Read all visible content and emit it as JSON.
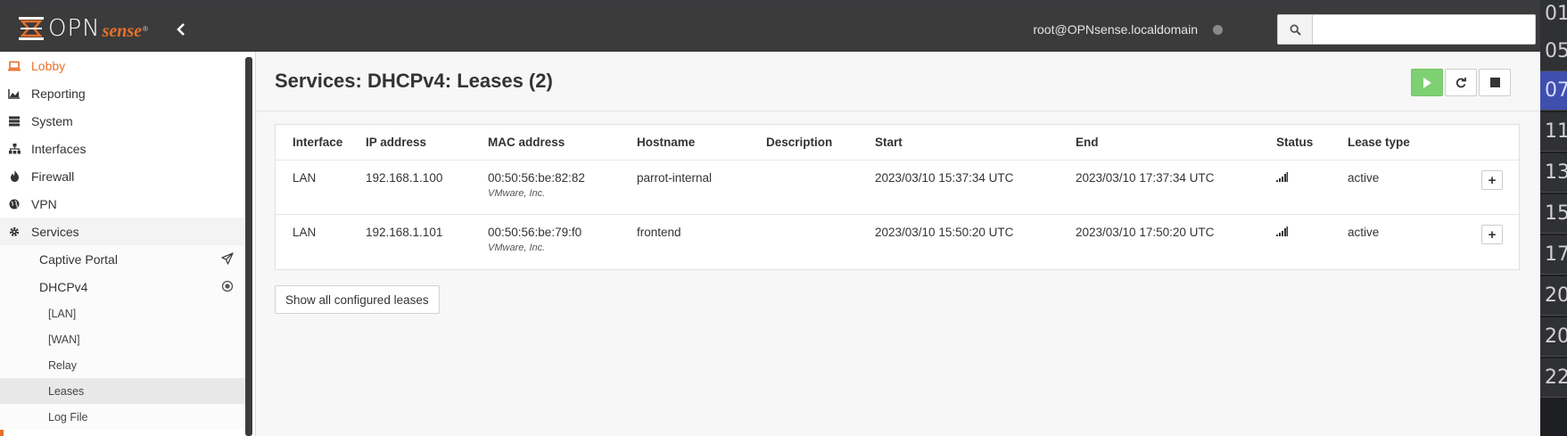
{
  "header": {
    "logo_text": "OPN",
    "logo_sense": "sense",
    "logo_reg": "®",
    "user": "root@OPNsense.localdomain",
    "search_placeholder": ""
  },
  "sidebar": {
    "items": [
      {
        "label": "Lobby",
        "icon": "laptop-icon"
      },
      {
        "label": "Reporting",
        "icon": "area-chart-icon"
      },
      {
        "label": "System",
        "icon": "server-icon"
      },
      {
        "label": "Interfaces",
        "icon": "sitemap-icon"
      },
      {
        "label": "Firewall",
        "icon": "fire-icon"
      },
      {
        "label": "VPN",
        "icon": "globe-icon"
      },
      {
        "label": "Services",
        "icon": "cog-icon"
      }
    ],
    "services_sub": [
      {
        "label": "Captive Portal",
        "icon": "paper-plane-icon"
      },
      {
        "label": "DHCPv4",
        "icon": "bullseye-icon"
      }
    ],
    "dhcp_sub": [
      {
        "label": "[LAN]"
      },
      {
        "label": "[WAN]"
      },
      {
        "label": "Relay"
      },
      {
        "label": "Leases"
      },
      {
        "label": "Log File"
      }
    ]
  },
  "page": {
    "title": "Services: DHCPv4: Leases (2)",
    "show_all_label": "Show all configured leases"
  },
  "table": {
    "columns": [
      "Interface",
      "IP address",
      "MAC address",
      "Hostname",
      "Description",
      "Start",
      "End",
      "Status",
      "Lease type"
    ],
    "rows": [
      {
        "interface": "LAN",
        "ip": "192.168.1.100",
        "mac": "00:50:56:be:82:82",
        "vendor": "VMware, Inc.",
        "hostname": "parrot-internal",
        "description": "",
        "start": "2023/03/10 15:37:34 UTC",
        "end": "2023/03/10 17:37:34 UTC",
        "status_icon": "signal-icon",
        "lease_type": "active"
      },
      {
        "interface": "LAN",
        "ip": "192.168.1.101",
        "mac": "00:50:56:be:79:f0",
        "vendor": "VMware, Inc.",
        "hostname": "frontend",
        "description": "",
        "start": "2023/03/10 15:50:20 UTC",
        "end": "2023/03/10 17:50:20 UTC",
        "status_icon": "signal-icon",
        "lease_type": "active"
      }
    ]
  },
  "clock_strip": [
    "01",
    "05",
    "07",
    "11",
    "13",
    "15",
    "17",
    "20",
    "20",
    "22"
  ],
  "colors": {
    "accent": "#e8702a",
    "navbar": "#3b3b3b",
    "play_button": "#7ed073",
    "highlight": "#3e4fae"
  }
}
